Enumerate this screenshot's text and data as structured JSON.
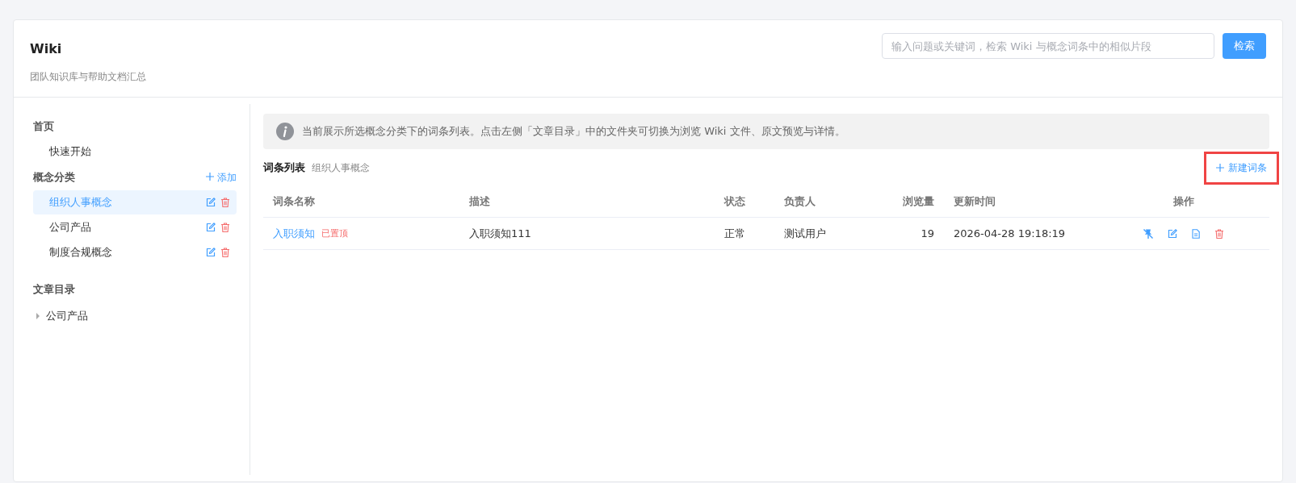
{
  "header": {
    "title": "Wiki",
    "subtitle": "团队知识库与帮助文档汇总",
    "search": {
      "placeholder": "输入问题或关键词，检索 Wiki 与概念词条中的相似片段"
    },
    "search_button": "检索"
  },
  "sidebar": {
    "sections": [
      {
        "kind": "plain",
        "title": "首页",
        "items": [
          {
            "label": "快速开始",
            "selected": false
          }
        ]
      },
      {
        "kind": "categories",
        "title": "概念分类",
        "add_label": "添加",
        "items": [
          {
            "label": "组织人事概念",
            "selected": true
          },
          {
            "label": "公司产品",
            "selected": false
          },
          {
            "label": "制度合规概念",
            "selected": false
          }
        ]
      },
      {
        "kind": "tree",
        "title": "文章目录",
        "items": [
          {
            "label": "公司产品",
            "expanded": false
          }
        ]
      }
    ]
  },
  "notice": "当前展示所选概念分类下的词条列表。点击左侧「文章目录」中的文件夹可切换为浏览 Wiki 文件、原文预览与详情。",
  "list": {
    "title": "词条列表",
    "subtitle": "组织人事概念",
    "new_button": {
      "label": "新建词条",
      "highlighted": true
    }
  },
  "table": {
    "columns": [
      "词条名称",
      "描述",
      "状态",
      "负责人",
      "浏览量",
      "更新时间",
      "操作"
    ],
    "rows": [
      {
        "name": "入职须知",
        "badge": "已置顶",
        "description": "入职须知111",
        "status": "正常",
        "owner": "测试用户",
        "views": "19",
        "updated": "2026-04-28 19:18:19"
      }
    ]
  }
}
